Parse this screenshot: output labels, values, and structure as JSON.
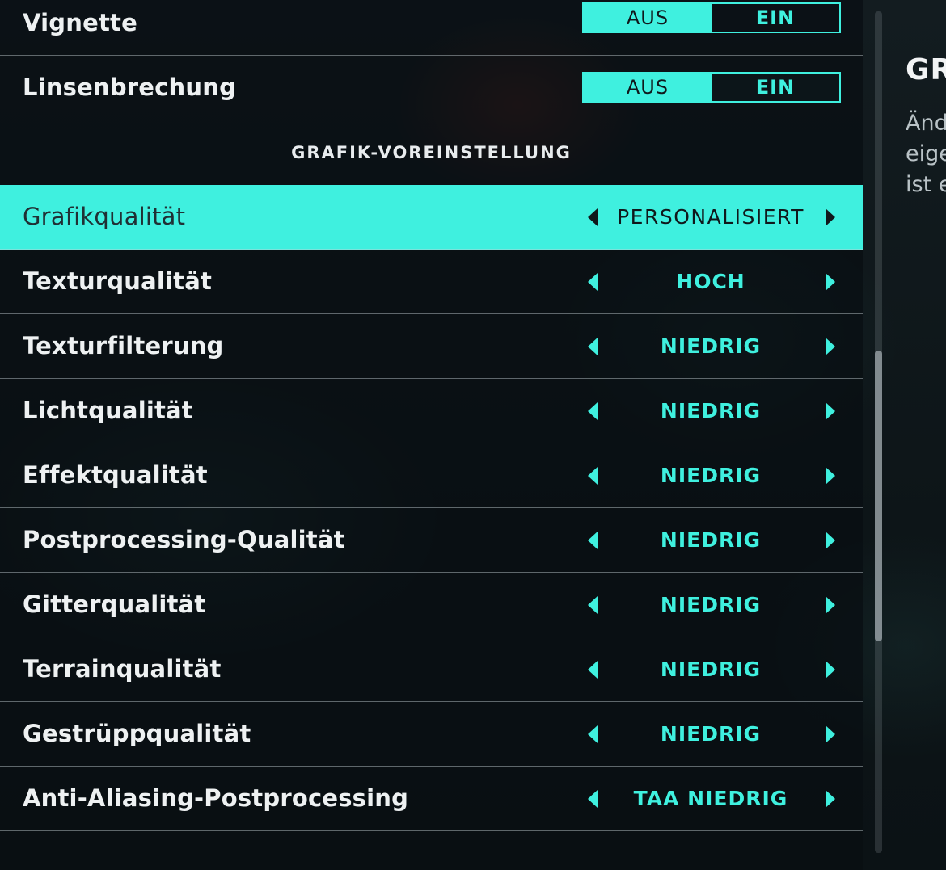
{
  "toggles": [
    {
      "label": "Vignette",
      "off_label": "AUS",
      "on_label": "EIN"
    },
    {
      "label": "Linsenbrechung",
      "off_label": "AUS",
      "on_label": "EIN"
    }
  ],
  "section": {
    "title": "GRAFIK-VOREINSTELLUNG"
  },
  "settings": [
    {
      "label": "Grafikqualität",
      "value": "PERSONALISIERT",
      "selected": true
    },
    {
      "label": "Texturqualität",
      "value": "HOCH"
    },
    {
      "label": "Texturfilterung",
      "value": "NIEDRIG"
    },
    {
      "label": "Lichtqualität",
      "value": "NIEDRIG"
    },
    {
      "label": "Effektqualität",
      "value": "NIEDRIG"
    },
    {
      "label": "Postprocessing-Qualität",
      "value": "NIEDRIG"
    },
    {
      "label": "Gitterqualität",
      "value": "NIEDRIG"
    },
    {
      "label": "Terrainqualität",
      "value": "NIEDRIG"
    },
    {
      "label": "Gestrüppqualität",
      "value": "NIEDRIG"
    },
    {
      "label": "Anti-Aliasing-Postprocessing",
      "value": "TAA NIEDRIG"
    }
  ],
  "info_panel": {
    "title": "GR",
    "text": "Änd\neige\nist e"
  },
  "colors": {
    "accent": "#3ff0df",
    "background": "#0c1418"
  }
}
